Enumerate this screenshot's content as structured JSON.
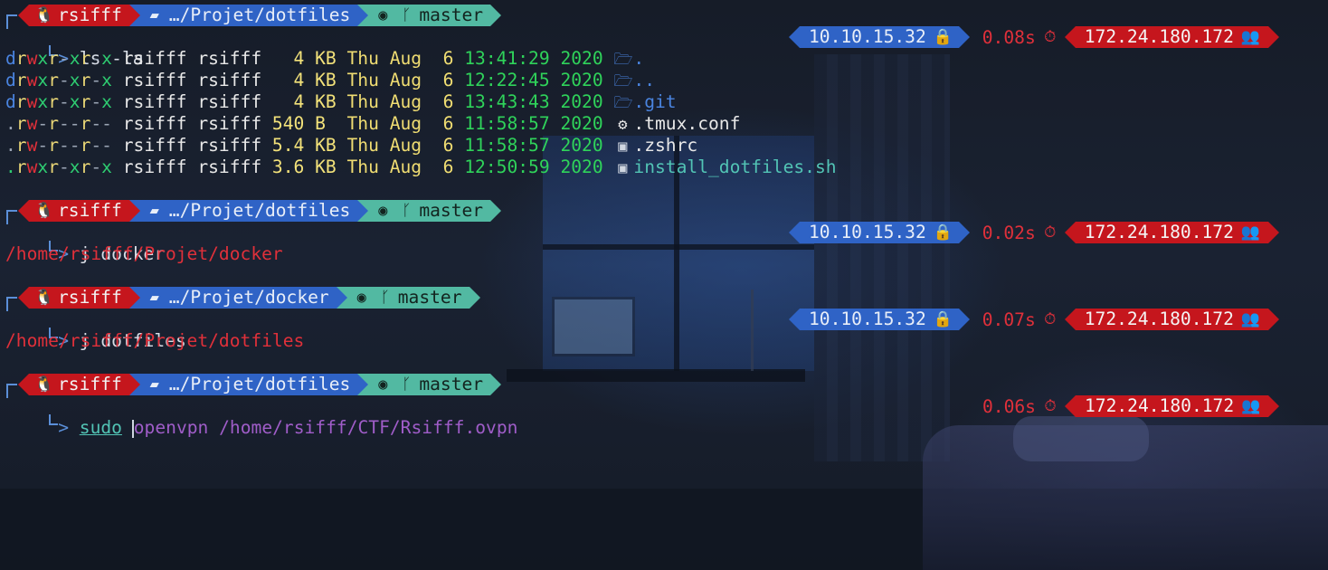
{
  "prompt": {
    "user": "rsifff",
    "vpn_ip": "10.10.15.32",
    "host_ip": "172.24.180.172",
    "branch": "master"
  },
  "blocks": [
    {
      "path": "…/Projet/dotfiles",
      "command": "ls -la",
      "cmd_time": "0.08s"
    },
    {
      "path": "…/Projet/dotfiles",
      "command": "j docker",
      "cmd_time": "0.02s",
      "output": "/home/rsifff/Projet/docker"
    },
    {
      "path": "…/Projet/docker",
      "command": "j dotfiles",
      "cmd_time": "0.07s",
      "output": "/home/rsifff/Projet/dotfiles"
    },
    {
      "path": "…/Projet/dotfiles",
      "command_sudo": "sudo",
      "command_bin": "openvpn",
      "command_arg": "/home/rsifff/CTF/Rsifff.ovpn",
      "cmd_time": "0.06s"
    }
  ],
  "listing": [
    {
      "perm_d": "d",
      "perm_r1": "r",
      "perm_w1": "w",
      "perm_x1": "x",
      "perm_r2": "r",
      "perm_d2": "-",
      "perm_x2": "x",
      "perm_r3": "r",
      "perm_d3": "-",
      "perm_x3": "x",
      "owner": "rsifff",
      "group": "rsifff",
      "size": "  4",
      "unit": "KB",
      "day": "Thu",
      "month": "Aug",
      "date": " 6",
      "time": "13:41:29",
      "year": "2020",
      "icon": "folder-open-icon",
      "name": "."
    },
    {
      "perm_d": "d",
      "perm_r1": "r",
      "perm_w1": "w",
      "perm_x1": "x",
      "perm_r2": "r",
      "perm_d2": "-",
      "perm_x2": "x",
      "perm_r3": "r",
      "perm_d3": "-",
      "perm_x3": "x",
      "owner": "rsifff",
      "group": "rsifff",
      "size": "  4",
      "unit": "KB",
      "day": "Thu",
      "month": "Aug",
      "date": " 6",
      "time": "12:22:45",
      "year": "2020",
      "icon": "folder-open-icon",
      "name": ".."
    },
    {
      "perm_d": "d",
      "perm_r1": "r",
      "perm_w1": "w",
      "perm_x1": "x",
      "perm_r2": "r",
      "perm_d2": "-",
      "perm_x2": "x",
      "perm_r3": "r",
      "perm_d3": "-",
      "perm_x3": "x",
      "owner": "rsifff",
      "group": "rsifff",
      "size": "  4",
      "unit": "KB",
      "day": "Thu",
      "month": "Aug",
      "date": " 6",
      "time": "13:43:43",
      "year": "2020",
      "icon": "folder-open-icon",
      "name": ".git"
    },
    {
      "perm_d": ".",
      "perm_r1": "r",
      "perm_w1": "w",
      "perm_x1": "-",
      "perm_r2": "r",
      "perm_d2": "-",
      "perm_x2": "-",
      "perm_r3": "r",
      "perm_d3": "-",
      "perm_x3": "-",
      "owner": "rsifff",
      "group": "rsifff",
      "size": "540",
      "unit": "B ",
      "day": "Thu",
      "month": "Aug",
      "date": " 6",
      "time": "11:58:57",
      "year": "2020",
      "icon": "gear-icon",
      "name": ".tmux.conf"
    },
    {
      "perm_d": ".",
      "perm_r1": "r",
      "perm_w1": "w",
      "perm_x1": "-",
      "perm_r2": "r",
      "perm_d2": "-",
      "perm_x2": "-",
      "perm_r3": "r",
      "perm_d3": "-",
      "perm_x3": "-",
      "owner": "rsifff",
      "group": "rsifff",
      "size": "5.4",
      "unit": "KB",
      "day": "Thu",
      "month": "Aug",
      "date": " 6",
      "time": "11:58:57",
      "year": "2020",
      "icon": "terminal-icon",
      "name": ".zshrc"
    },
    {
      "perm_d": ".",
      "perm_r1": "r",
      "perm_w1": "w",
      "perm_x1": "x",
      "perm_r2": "r",
      "perm_d2": "-",
      "perm_x2": "x",
      "perm_r3": "r",
      "perm_d3": "-",
      "perm_x3": "x",
      "owner": "rsifff",
      "group": "rsifff",
      "size": "3.6",
      "unit": "KB",
      "day": "Thu",
      "month": "Aug",
      "date": " 6",
      "time": "12:50:59",
      "year": "2020",
      "icon": "terminal-icon",
      "name": "install_dotfiles.sh"
    }
  ],
  "colors": {
    "prompt_red": "#c5161d",
    "prompt_blue": "#2f63c6",
    "prompt_teal": "#52b9a2",
    "path_output": "#e0303a"
  }
}
